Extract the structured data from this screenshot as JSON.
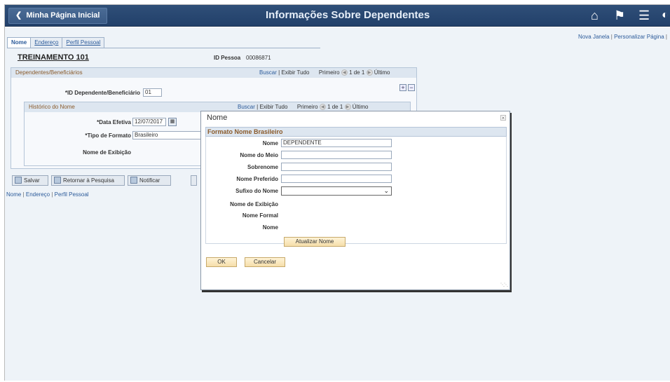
{
  "banner": {
    "home_label": "Minha Página Inicial",
    "title": "Informações Sobre Dependentes"
  },
  "toplinks": {
    "new_window": "Nova Janela",
    "personalize": "Personalizar Página"
  },
  "tabs": [
    {
      "label": "Nome",
      "active": true
    },
    {
      "label": "Endereço",
      "active": false
    },
    {
      "label": "Perfil Pessoal",
      "active": false
    }
  ],
  "header": {
    "name": "TREINAMENTO 101",
    "id_label": "ID Pessoa",
    "id_value": "00086871"
  },
  "dependents": {
    "title": "Dependentes/Beneficiários",
    "find": "Buscar",
    "view_all": "Exibir Tudo",
    "first": "Primeiro",
    "count": "1 de 1",
    "last": "Último",
    "id_label": "*ID Dependente/Beneficiário",
    "id_value": "01"
  },
  "history": {
    "title": "Histórico do Nome",
    "find": "Buscar",
    "view_all": "Exibir Tudo",
    "first": "Primeiro",
    "count": "1 de 1",
    "last": "Último",
    "eff_date_label": "*Data Efetiva",
    "eff_date_value": "12/07/2017",
    "format_label": "*Tipo de Formato",
    "format_value": "Brasileiro",
    "display_label": "Nome de Exibição"
  },
  "buttons": {
    "save": "Salvar",
    "return": "Retornar à Pesquisa",
    "notify": "Notificar"
  },
  "footlinks": [
    "Nome",
    "Endereço",
    "Perfil Pessoal"
  ],
  "modal": {
    "title": "Nome",
    "close": "×",
    "section": "Formato Nome Brasileiro",
    "fields": {
      "nome_label": "Nome",
      "nome_value": "DEPENDENTE",
      "meio_label": "Nome do Meio",
      "meio_value": "",
      "sobrenome_label": "Sobrenome",
      "sobrenome_value": "",
      "preferido_label": "Nome Preferido",
      "preferido_value": "",
      "sufixo_label": "Sufixo do Nome",
      "sufixo_value": "",
      "exibicao_label": "Nome de Exibição",
      "formal_label": "Nome Formal",
      "nome2_label": "Nome"
    },
    "update_button": "Atualizar Nome",
    "ok_button": "OK",
    "cancel_button": "Cancelar"
  }
}
